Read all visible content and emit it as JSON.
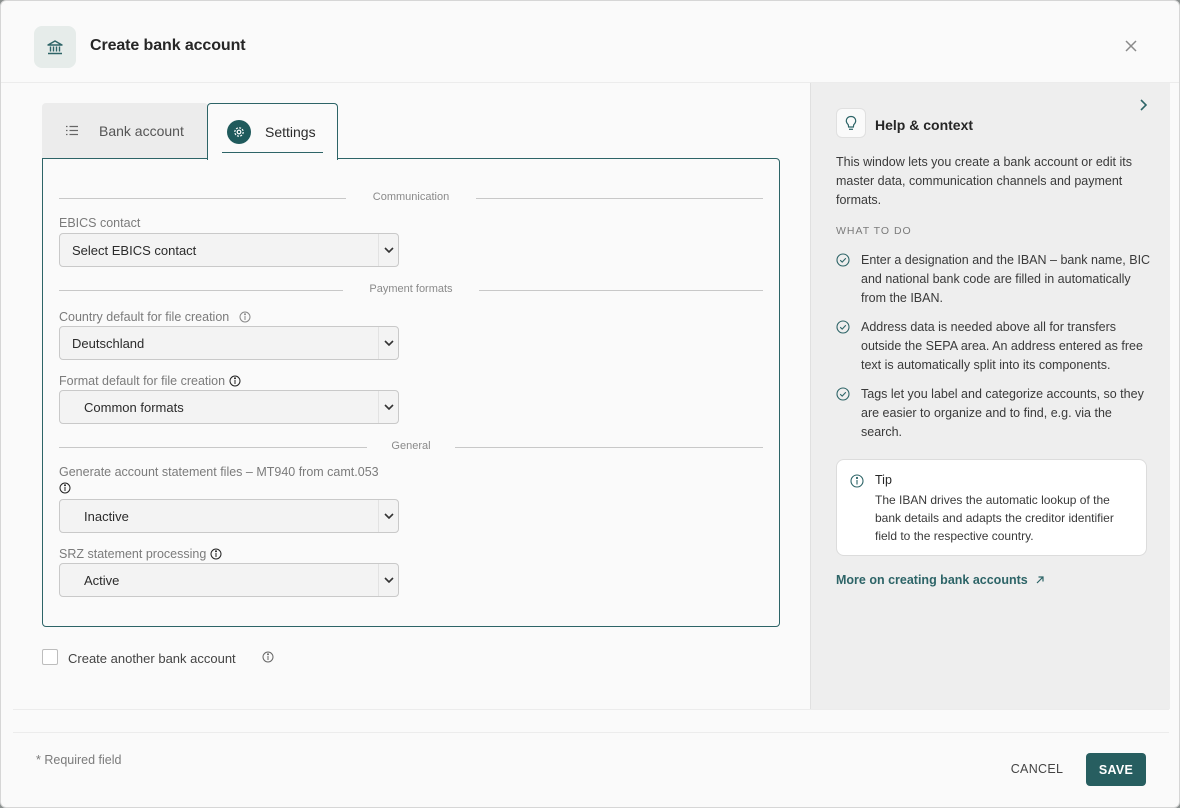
{
  "dialog": {
    "title": "Create bank account",
    "icon": "bank-icon",
    "close_icon": "close-icon"
  },
  "tabs": [
    {
      "label": "Bank account",
      "icon": "list-icon",
      "active": false
    },
    {
      "label": "Settings",
      "icon": "gear-icon",
      "active": true
    }
  ],
  "sections": {
    "communication": "Communication",
    "payment_formats": "Payment formats",
    "general": "General"
  },
  "fields": {
    "ebics_contact": {
      "label": "EBICS contact",
      "value": "Select EBICS contact"
    },
    "country_default": {
      "label": "Country default for file creation",
      "value": "Deutschland"
    },
    "format_default": {
      "label": "Format default for file creation",
      "value": "Common formats"
    },
    "mt940": {
      "label": "Generate account statement files – MT940 from camt.053",
      "value": "Inactive"
    },
    "srz": {
      "label": "SRZ statement processing",
      "value": "Active"
    }
  },
  "create_another": {
    "label": "Create another bank account",
    "checked": false
  },
  "help": {
    "title": "Help & context",
    "intro": "This window lets you create a bank account or edit its master data, communication channels and payment formats.",
    "what_to_do_heading": "WHAT TO DO",
    "items": [
      "Enter a designation and the IBAN – bank name, BIC and national bank code are filled in automatically from the IBAN.",
      "Address data is needed above all for transfers outside the SEPA area. An address entered as free text is automatically split into its components.",
      "Tags let you label and categorize accounts, so they are easier to organize and to find, e.g. via the search."
    ],
    "tip": {
      "title": "Tip",
      "text": "The IBAN drives the automatic lookup of the bank details and adapts the creditor identifier field to the respective country."
    },
    "link": "More on creating bank accounts"
  },
  "footer": {
    "required_note": "* Required field",
    "cancel": "CANCEL",
    "save": "SAVE"
  },
  "colors": {
    "accent": "#275e60",
    "panel_border": "#2d6467",
    "help_background": "#eeeeee"
  }
}
